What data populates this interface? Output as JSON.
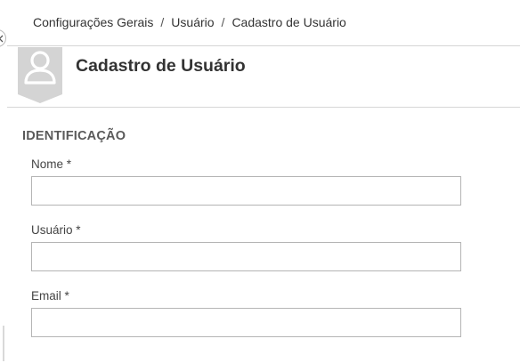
{
  "breadcrumb": {
    "items": [
      "Configurações Gerais",
      "Usuário",
      "Cadastro de Usuário"
    ],
    "separator": "/"
  },
  "header": {
    "title": "Cadastro de Usuário",
    "avatar_icon": "user-silhouette-icon"
  },
  "sidebar": {
    "collapse_icon": "chevron-left-icon"
  },
  "form": {
    "section_title": "IDENTIFICAÇÃO",
    "fields": [
      {
        "label": "Nome *",
        "value": "",
        "placeholder": ""
      },
      {
        "label": "Usuário *",
        "value": "",
        "placeholder": ""
      },
      {
        "label": "Email *",
        "value": "",
        "placeholder": ""
      }
    ]
  },
  "colors": {
    "avatar_background": "#d4d4d4",
    "avatar_silhouette": "#ffffff",
    "divider": "#d6d6d6",
    "input_border": "#b4b4b4"
  }
}
